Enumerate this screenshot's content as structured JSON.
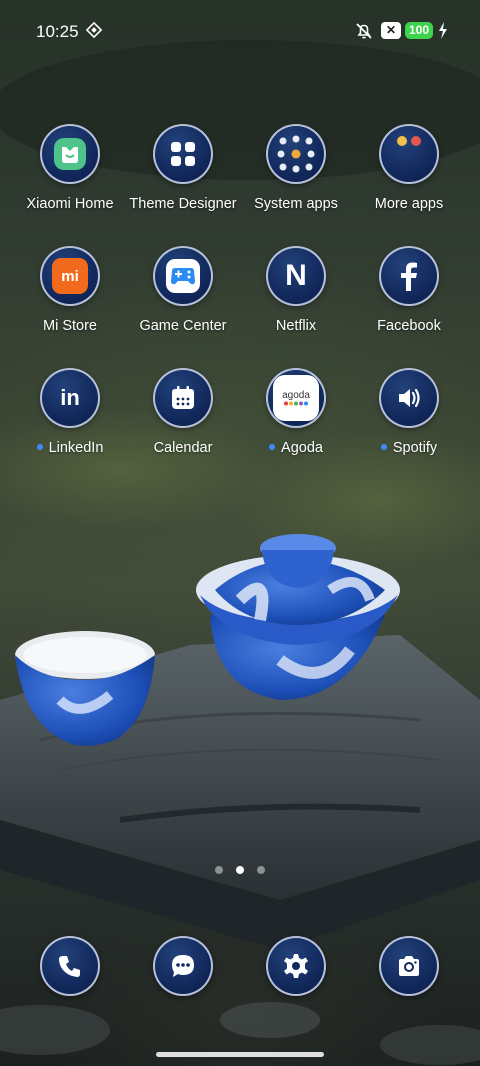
{
  "status_bar": {
    "time": "10:25",
    "battery": "100",
    "sim_badge": "✕"
  },
  "apps": [
    {
      "label": "Xiaomi Home",
      "icon": "xiaomi-home-icon",
      "dot": false
    },
    {
      "label": "Theme Designer",
      "icon": "grid-icon",
      "dot": false
    },
    {
      "label": "System apps",
      "icon": "folder-icon",
      "dot": false
    },
    {
      "label": "More apps",
      "icon": "folder-icon",
      "dot": false
    },
    {
      "label": "Mi Store",
      "icon": "mi-store-icon",
      "dot": false
    },
    {
      "label": "Game Center",
      "icon": "gamepad-icon",
      "dot": false
    },
    {
      "label": "Netflix",
      "icon": "netflix-icon",
      "dot": false
    },
    {
      "label": "Facebook",
      "icon": "facebook-icon",
      "dot": false
    },
    {
      "label": "LinkedIn",
      "icon": "linkedin-icon",
      "dot": true
    },
    {
      "label": "Calendar",
      "icon": "calendar-icon",
      "dot": false
    },
    {
      "label": "Agoda",
      "icon": "agoda-icon",
      "dot": true
    },
    {
      "label": "Spotify",
      "icon": "speaker-icon",
      "dot": true
    }
  ],
  "agoda_logo_text": "agoda",
  "mi_logo_text": "mi",
  "netflix_logo_text": "N",
  "linkedin_logo_text": "in",
  "page_indicator": {
    "pages": 3,
    "active": 2
  },
  "dock": [
    "phone-icon",
    "messages-icon",
    "settings-icon",
    "camera-icon"
  ],
  "colors": {
    "accent_dot": "#3d8bff",
    "battery": "#3dd34f",
    "icon_bg": "#11275a"
  }
}
